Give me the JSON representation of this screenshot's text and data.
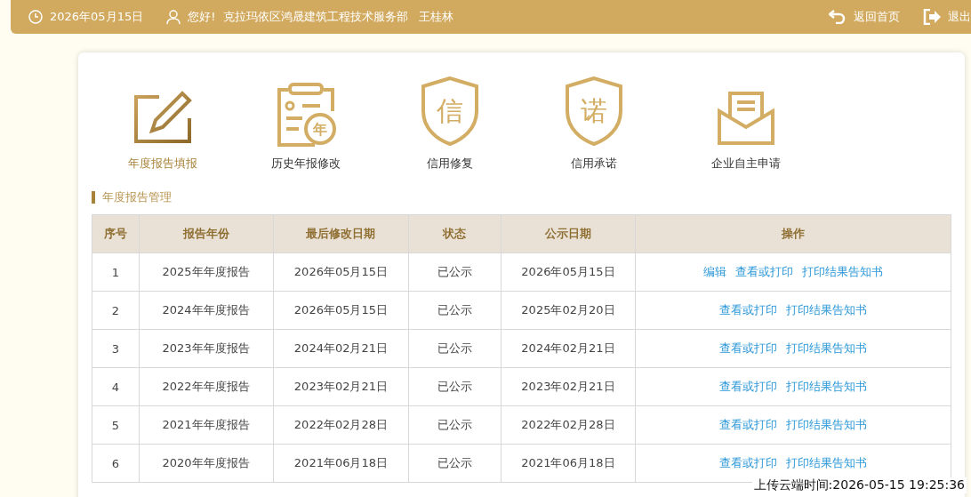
{
  "top_bar": {
    "date": "2026年05月15日",
    "greeting": "您好!  克拉玛依区鸿晟建筑工程技术服务部   王桂林",
    "home": "返回首页",
    "logout": "退出"
  },
  "nav": [
    {
      "kind": "edit",
      "label": "年度报告填报",
      "selected": true
    },
    {
      "kind": "history",
      "label": "历史年报修改",
      "selected": false,
      "badge": "年"
    },
    {
      "kind": "shield",
      "label": "信用修复",
      "selected": false,
      "badge": "信"
    },
    {
      "kind": "shield",
      "label": "信用承诺",
      "selected": false,
      "badge": "诺"
    },
    {
      "kind": "mail",
      "label": "企业自主申请",
      "selected": false
    }
  ],
  "section_title": "年度报告管理",
  "table": {
    "columns": [
      "序号",
      "报告年份",
      "最后修改日期",
      "状态",
      "公示日期",
      "操作"
    ],
    "rows": [
      {
        "cells": [
          "1",
          "2025年年度报告",
          "2026年05月15日",
          "已公示",
          "2026年05月15日"
        ],
        "actions": [
          "编辑",
          "查看或打印",
          "打印结果告知书"
        ]
      },
      {
        "cells": [
          "2",
          "2024年年度报告",
          "2026年05月15日",
          "已公示",
          "2025年02月20日"
        ],
        "actions": [
          "查看或打印",
          "打印结果告知书"
        ]
      },
      {
        "cells": [
          "3",
          "2023年年度报告",
          "2024年02月21日",
          "已公示",
          "2024年02月21日"
        ],
        "actions": [
          "查看或打印",
          "打印结果告知书"
        ]
      },
      {
        "cells": [
          "4",
          "2022年年度报告",
          "2023年02月21日",
          "已公示",
          "2023年02月21日"
        ],
        "actions": [
          "查看或打印",
          "打印结果告知书"
        ]
      },
      {
        "cells": [
          "5",
          "2021年年度报告",
          "2022年02月28日",
          "已公示",
          "2022年02月28日"
        ],
        "actions": [
          "查看或打印",
          "打印结果告知书"
        ]
      },
      {
        "cells": [
          "6",
          "2020年年度报告",
          "2021年06月18日",
          "已公示",
          "2021年06月18日"
        ],
        "actions": [
          "查看或打印",
          "打印结果告知书"
        ]
      }
    ]
  },
  "upload_time": "上传云端时间:2026-05-15 19:25:36"
}
